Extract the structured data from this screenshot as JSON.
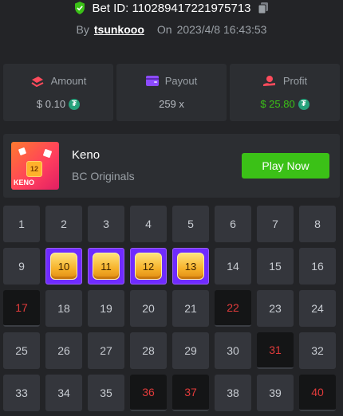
{
  "header": {
    "bet_id": "Bet ID: 110289417221975713",
    "by_label": "By",
    "username": "tsunkooo",
    "on_label": "On",
    "datetime": "2023/4/8 16:43:53",
    "shield_icon": "shield-check-icon",
    "copy_icon": "copy-icon"
  },
  "stats": [
    {
      "label": "Amount",
      "value": "$ 0.10",
      "icon": "money-icon",
      "currency_icon": "tether-icon",
      "color": "#b8bcc2"
    },
    {
      "label": "Payout",
      "value": "259 x",
      "icon": "wallet-icon",
      "color": "#b8bcc2"
    },
    {
      "label": "Profit",
      "value": "$ 25.80",
      "icon": "profit-hand-icon",
      "currency_icon": "tether-icon",
      "color": "#3bc117"
    }
  ],
  "game": {
    "name": "Keno",
    "provider": "BC Originals",
    "play_label": "Play Now",
    "thumb_number": "12",
    "thumb_logo": "KENO"
  },
  "board": {
    "numbers": [
      1,
      2,
      3,
      4,
      5,
      6,
      7,
      8,
      9,
      10,
      11,
      12,
      13,
      14,
      15,
      16,
      17,
      18,
      19,
      20,
      21,
      22,
      23,
      24,
      25,
      26,
      27,
      28,
      29,
      30,
      31,
      32,
      33,
      34,
      35,
      36,
      37,
      38,
      39,
      40
    ],
    "hits": [
      10,
      11,
      12,
      13
    ],
    "misses": [
      17,
      22,
      31,
      36,
      37,
      40
    ]
  },
  "colors": {
    "accent_green": "#3bc117",
    "hit_purple": "#6f2bff",
    "miss_red": "#e23b3b",
    "background": "#232427"
  }
}
